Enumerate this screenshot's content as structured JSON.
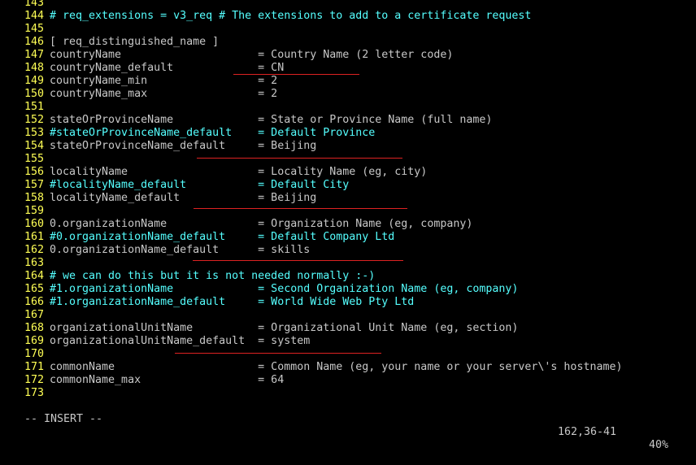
{
  "colors": {
    "background": "#000000",
    "line_number": "#ffff55",
    "text": "#c8c8c8",
    "comment": "#55ffff",
    "underline": "#dd2222"
  },
  "lines": [
    {
      "n": "143",
      "text": "",
      "type": "plain"
    },
    {
      "n": "144",
      "text": "# req_extensions = v3_req # The extensions to add to a certificate request",
      "type": "comment"
    },
    {
      "n": "145",
      "text": "",
      "type": "plain"
    },
    {
      "n": "146",
      "text": "[ req_distinguished_name ]",
      "type": "plain"
    },
    {
      "n": "147",
      "text": "countryName                     = Country Name (2 letter code)",
      "type": "plain"
    },
    {
      "n": "148",
      "text": "countryName_default             = CN",
      "type": "plain"
    },
    {
      "n": "149",
      "text": "countryName_min                 = 2",
      "type": "plain"
    },
    {
      "n": "150",
      "text": "countryName_max                 = 2",
      "type": "plain"
    },
    {
      "n": "151",
      "text": "",
      "type": "plain"
    },
    {
      "n": "152",
      "text": "stateOrProvinceName             = State or Province Name (full name)",
      "type": "plain"
    },
    {
      "n": "153",
      "text": "#stateOrProvinceName_default    = Default Province",
      "type": "comment"
    },
    {
      "n": "154",
      "text": "stateOrProvinceName_default     = Beijing",
      "type": "plain"
    },
    {
      "n": "155",
      "text": "",
      "type": "plain"
    },
    {
      "n": "156",
      "text": "localityName                    = Locality Name (eg, city)",
      "type": "plain"
    },
    {
      "n": "157",
      "text": "#localityName_default           = Default City",
      "type": "comment"
    },
    {
      "n": "158",
      "text": "localityName_default            = Beijing",
      "type": "plain"
    },
    {
      "n": "159",
      "text": "",
      "type": "plain"
    },
    {
      "n": "160",
      "text": "0.organizationName              = Organization Name (eg, company)",
      "type": "plain"
    },
    {
      "n": "161",
      "text": "#0.organizationName_default     = Default Company Ltd",
      "type": "comment"
    },
    {
      "n": "162",
      "text": "0.organizationName_default      = skills",
      "type": "plain"
    },
    {
      "n": "163",
      "text": "",
      "type": "plain"
    },
    {
      "n": "164",
      "text": "# we can do this but it is not needed normally :-)",
      "type": "comment"
    },
    {
      "n": "165",
      "text": "#1.organizationName             = Second Organization Name (eg, company)",
      "type": "comment"
    },
    {
      "n": "166",
      "text": "#1.organizationName_default     = World Wide Web Pty Ltd",
      "type": "comment"
    },
    {
      "n": "167",
      "text": "",
      "type": "plain"
    },
    {
      "n": "168",
      "text": "organizationalUnitName          = Organizational Unit Name (eg, section)",
      "type": "plain"
    },
    {
      "n": "169",
      "text": "organizationalUnitName_default  = system",
      "type": "plain"
    },
    {
      "n": "170",
      "text": "",
      "type": "plain"
    },
    {
      "n": "171",
      "text": "commonName                      = Common Name (eg, your name or your server\\'s hostname)",
      "type": "plain"
    },
    {
      "n": "172",
      "text": "commonName_max                  = 64",
      "type": "plain"
    },
    {
      "n": "173",
      "text": "",
      "type": "plain"
    }
  ],
  "status": {
    "mode": "-- INSERT --",
    "position": "162,36-41",
    "percent": "40%"
  }
}
